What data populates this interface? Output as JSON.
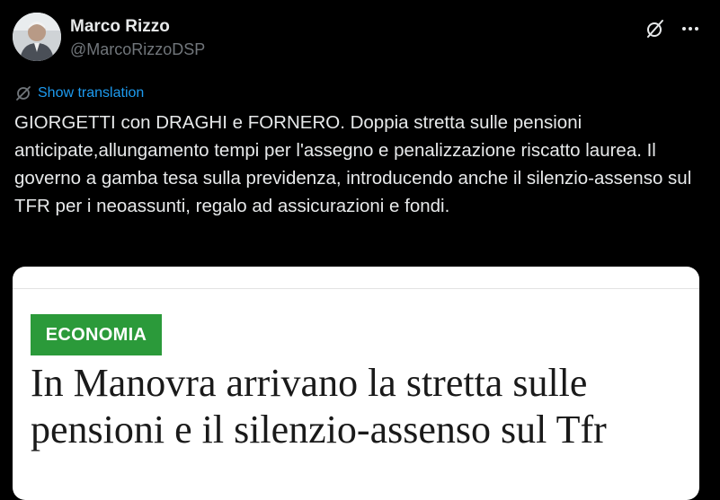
{
  "author": {
    "name": "Marco Rizzo",
    "handle": "@MarcoRizzoDSP",
    "avatar_icon": "avatar-photo"
  },
  "actions": {
    "grok_icon": "grok-icon",
    "more_icon": "more-icon"
  },
  "translate": {
    "label": "Show translation",
    "icon": "translate-icon"
  },
  "tweet": {
    "text": "GIORGETTI con DRAGHI e FORNERO. Doppia stretta sulle pensioni anticipate,allungamento tempi per l'assegno e penalizzazione riscatto laurea. Il governo a gamba tesa sulla previdenza, introducendo anche il silenzio-assenso sul TFR per i neoassunti, regalo ad assicurazioni e fondi."
  },
  "card": {
    "badge": "ECONOMIA",
    "badge_color": "#2b9a3a",
    "headline": "In Manovra arrivano la stretta sulle pensioni e il silenzio-assenso sul Tfr"
  },
  "colors": {
    "background": "#000000",
    "text": "#e7e9ea",
    "muted": "#71767b",
    "link": "#1d9bf0"
  }
}
